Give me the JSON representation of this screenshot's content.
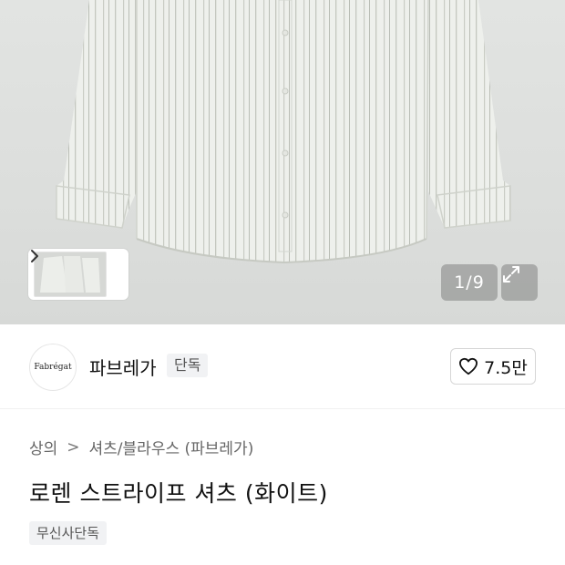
{
  "gallery": {
    "counter": "1/9",
    "thumb_next_icon": "chevron-right-icon",
    "expand_icon": "expand-icon"
  },
  "brand": {
    "logo_text": "Fabrégat",
    "name": "파브레가",
    "badge": "단독",
    "like_icon": "heart-icon",
    "like_count": "7.5만"
  },
  "product": {
    "breadcrumb": {
      "level1": "상의",
      "separator": ">",
      "level2": "셔츠/블라우스 (파브레가)"
    },
    "title": "로렌 스트라이프 셔츠 (화이트)",
    "store_tag": "무신사단독"
  }
}
